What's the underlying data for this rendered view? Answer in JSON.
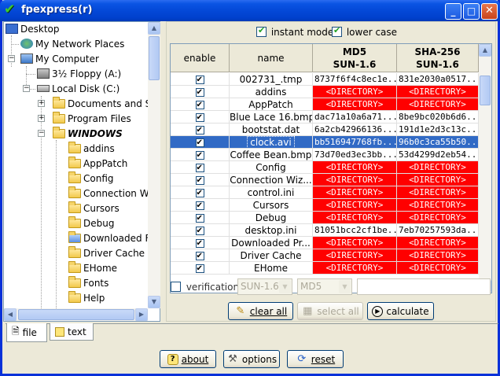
{
  "window": {
    "title": "fpexpress(r)"
  },
  "titlebar_buttons": {
    "minimize": "_",
    "maximize": "□",
    "close": "✕"
  },
  "tree": {
    "items": [
      {
        "label": "Desktop",
        "icon": "desktop-icon"
      },
      {
        "label": "My Network Places",
        "icon": "network-icon"
      },
      {
        "label": "My Computer",
        "icon": "computer-icon"
      },
      {
        "label": "3½ Floppy (A:)",
        "icon": "floppy-icon"
      },
      {
        "label": "Local Disk (C:)",
        "icon": "disk-icon"
      },
      {
        "label": "Documents and S",
        "icon": "folder-icon"
      },
      {
        "label": "Program Files",
        "icon": "folder-icon"
      },
      {
        "label": "WINDOWS",
        "icon": "folder-open-icon"
      },
      {
        "label": "addins",
        "icon": "folder-icon"
      },
      {
        "label": "AppPatch",
        "icon": "folder-icon"
      },
      {
        "label": "Config",
        "icon": "folder-icon"
      },
      {
        "label": "Connection W",
        "icon": "folder-icon"
      },
      {
        "label": "Cursors",
        "icon": "folder-icon"
      },
      {
        "label": "Debug",
        "icon": "folder-icon"
      },
      {
        "label": "Downloaded F",
        "icon": "folder-special-icon"
      },
      {
        "label": "Driver Cache",
        "icon": "folder-icon"
      },
      {
        "label": "EHome",
        "icon": "folder-icon"
      },
      {
        "label": "Fonts",
        "icon": "folder-icon"
      },
      {
        "label": "Help",
        "icon": "folder-icon"
      }
    ]
  },
  "options": {
    "instant_mode": "instant mode",
    "lower_case": "lower case"
  },
  "table": {
    "headers": {
      "enable": "enable",
      "name": "name",
      "md5_line1": "MD5",
      "md5_line2": "SUN-1.6",
      "sha_line1": "SHA-256",
      "sha_line2": "SUN-1.6"
    },
    "rows": [
      {
        "name": "002731_.tmp",
        "md5": "8737f6f4c8ec1e...",
        "sha": "831e2030a0517..."
      },
      {
        "name": "addins",
        "md5": "<DIRECTORY>",
        "sha": "<DIRECTORY>"
      },
      {
        "name": "AppPatch",
        "md5": "<DIRECTORY>",
        "sha": "<DIRECTORY>"
      },
      {
        "name": "Blue Lace 16.bmp",
        "md5": "dac71a10a6a71...",
        "sha": "8be9bc020b6d6..."
      },
      {
        "name": "bootstat.dat",
        "md5": "6a2cb42966136...",
        "sha": "191d1e2d3c13c..."
      },
      {
        "name": "clock.avi",
        "md5": "bb516947768fb...",
        "sha": "96b0c3ca55b50..."
      },
      {
        "name": "Coffee Bean.bmp",
        "md5": "73d70ed3ec3bb...",
        "sha": "53d4299d2eb54..."
      },
      {
        "name": "Config",
        "md5": "<DIRECTORY>",
        "sha": "<DIRECTORY>"
      },
      {
        "name": "Connection Wiz...",
        "md5": "<DIRECTORY>",
        "sha": "<DIRECTORY>"
      },
      {
        "name": "control.ini",
        "md5": "<DIRECTORY>",
        "sha": "<DIRECTORY>"
      },
      {
        "name": "Cursors",
        "md5": "<DIRECTORY>",
        "sha": "<DIRECTORY>"
      },
      {
        "name": "Debug",
        "md5": "<DIRECTORY>",
        "sha": "<DIRECTORY>"
      },
      {
        "name": "desktop.ini",
        "md5": "81051bcc2cf1be...",
        "sha": "7eb70257593da..."
      },
      {
        "name": "Downloaded Pr...",
        "md5": "<DIRECTORY>",
        "sha": "<DIRECTORY>"
      },
      {
        "name": "Driver Cache",
        "md5": "<DIRECTORY>",
        "sha": "<DIRECTORY>"
      },
      {
        "name": "EHome",
        "md5": "<DIRECTORY>",
        "sha": "<DIRECTORY>"
      }
    ]
  },
  "verification": {
    "label": "verification",
    "algo1": "SUN-1.6",
    "algo2": "MD5",
    "input_value": ""
  },
  "actions": {
    "clear_all": "clear all",
    "select_all": "select all",
    "calculate": "calculate"
  },
  "tabs": {
    "file": "file",
    "text": "text"
  },
  "footer": {
    "about": "about",
    "options": "options",
    "reset": "reset"
  },
  "colors": {
    "directory_bg": "#ff0000",
    "selection": "#316ac5",
    "titlebar": "#0a54e3"
  }
}
